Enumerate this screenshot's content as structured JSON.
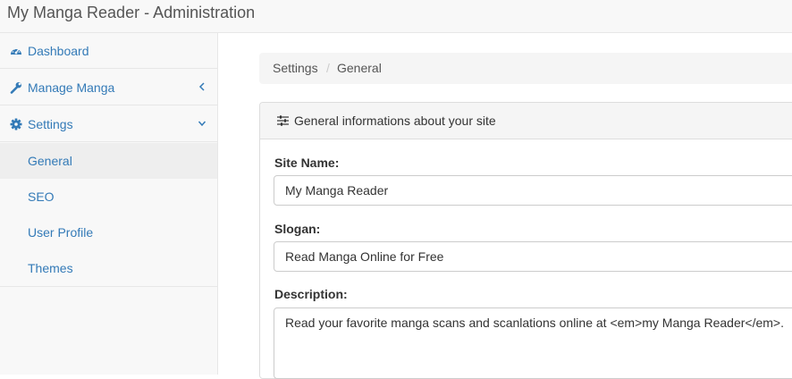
{
  "app": {
    "title": "My Manga Reader - Administration"
  },
  "sidebar": {
    "items": [
      {
        "label": "Dashboard",
        "icon": "dashboard-icon"
      },
      {
        "label": "Manage Manga",
        "icon": "wrench-icon",
        "arrow": "chevron-left-icon"
      },
      {
        "label": "Settings",
        "icon": "gear-icon",
        "arrow": "chevron-down-icon"
      }
    ],
    "subitems": [
      {
        "label": "General",
        "active": true
      },
      {
        "label": "SEO"
      },
      {
        "label": "User Profile"
      },
      {
        "label": "Themes"
      }
    ]
  },
  "breadcrumb": {
    "items": [
      "Settings",
      "General"
    ],
    "separator": "/"
  },
  "panel": {
    "title": "General informations about your site",
    "icon": "sliders-icon",
    "fields": {
      "site_name": {
        "label": "Site Name:",
        "value": "My Manga Reader"
      },
      "slogan": {
        "label": "Slogan:",
        "value": "Read Manga Online for Free"
      },
      "description": {
        "label": "Description:",
        "value": "Read your favorite manga scans and scanlations online at <em>my Manga Reader</em>."
      }
    }
  },
  "colors": {
    "link": "#337ab7",
    "navbar_bg": "#f8f8f8",
    "active_bg": "#eeeeee"
  }
}
